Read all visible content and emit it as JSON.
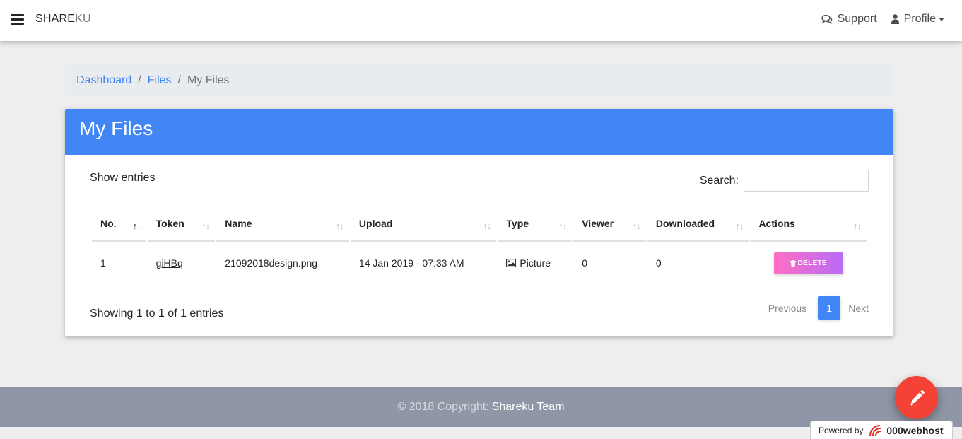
{
  "navbar": {
    "brand_main": "SHARE",
    "brand_accent": "KU",
    "support_label": "Support",
    "profile_label": "Profile"
  },
  "breadcrumb": {
    "items": [
      "Dashboard",
      "Files",
      "My Files"
    ]
  },
  "card": {
    "title": "My Files",
    "show_entries_label": "Show entries",
    "search_label": "Search:",
    "search_value": "",
    "columns": [
      "No.",
      "Token",
      "Name",
      "Upload",
      "Type",
      "Viewer",
      "Downloaded",
      "Actions"
    ],
    "rows": [
      {
        "no": "1",
        "token": "giHBq",
        "name": "21092018design.png",
        "upload": "14 Jan 2019 - 07:33 AM",
        "type": "Picture",
        "viewer": "0",
        "downloaded": "0",
        "action_label": "DELETE"
      }
    ],
    "showing_text": "Showing 1 to 1 of 1 entries",
    "pagination": {
      "previous": "Previous",
      "current": "1",
      "next": "Next"
    }
  },
  "footer": {
    "copyright": "© 2018 Copyright:",
    "team": "Shareku Team"
  },
  "powered": {
    "label": "Powered by",
    "host": "000webhost"
  },
  "colors": {
    "primary": "#4285f4",
    "fab": "#f44336",
    "footer": "#8f96a5",
    "delete_gradient": [
      "#ff6ec4",
      "#b86cf5"
    ]
  },
  "icons": {
    "menu": "hamburger-icon",
    "support": "comments-icon",
    "profile": "user-icon",
    "type": "image-icon",
    "delete": "trash-icon",
    "fab": "pencil-icon"
  }
}
